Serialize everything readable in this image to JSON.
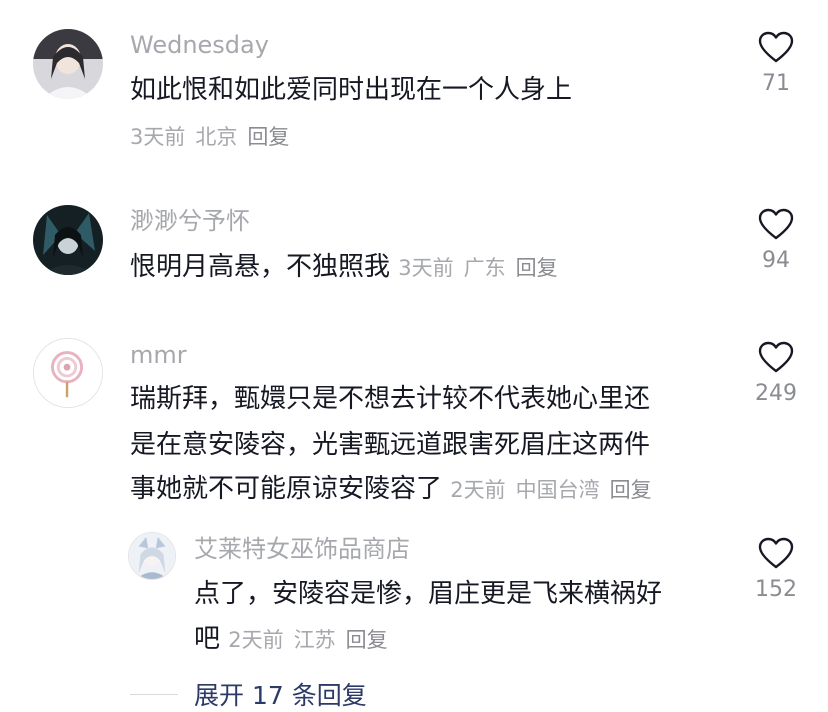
{
  "comments": [
    {
      "username": "Wednesday",
      "lines": [
        "如此恨和如此爱同时出现在一个人身上"
      ],
      "time": "3天前",
      "location": "北京",
      "reply": "回复",
      "likes": "71",
      "avatar_icon": "avatar-girl-photo"
    },
    {
      "username": "渺渺兮予怀",
      "lines": [
        "恨明月高悬，不独照我"
      ],
      "time": "3天前",
      "location": "广东",
      "reply": "回复",
      "likes": "94",
      "avatar_icon": "avatar-anime-dark"
    },
    {
      "username": "mmr",
      "lines": [
        "瑞斯拜，甄嬛只是不想去计较不代表她心里还",
        "是在意安陵容，光害甄远道跟害死眉庄这两件",
        "事她就不可能原谅安陵容了"
      ],
      "time": "2天前",
      "location": "中国台湾",
      "reply": "回复",
      "likes": "249",
      "avatar_icon": "avatar-lollipop"
    }
  ],
  "sub_reply": {
    "username": "艾莱特女巫饰品商店",
    "lines": [
      "点了，安陵容是惨，眉庄更是飞来横祸好",
      "吧"
    ],
    "time": "2天前",
    "location": "江苏",
    "reply": "回复",
    "likes": "152",
    "avatar_icon": "avatar-anime-silver"
  },
  "expand_replies": "展开 17 条回复",
  "colors": {
    "text": "#161823",
    "muted": "#a6a8ad",
    "link": "#2b3a67"
  }
}
